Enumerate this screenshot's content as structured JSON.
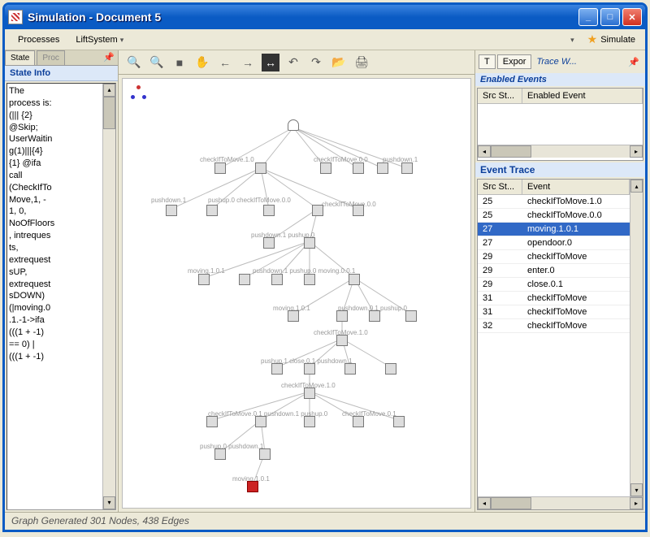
{
  "window": {
    "title": "Simulation - Document 5"
  },
  "menu": {
    "processes": "Processes",
    "liftsystem": "LiftSystem",
    "simulate": "Simulate"
  },
  "left": {
    "tabs": {
      "state": "State",
      "proc": "Proc",
      "pin": "📌"
    },
    "title": "State Info",
    "text": "The\nprocess is:\n(||| {2}\n@Skip;\nUserWaitin\ng(1)|||{4}\n{1} @ifa\ncall\n(CheckIfTo\nMove,1, -\n1, 0,\nNoOfFloors\n, intreques\nts,\nextrequest\nsUP,\nextrequest\nsDOWN)\n(|moving.0\n.1.-1->ifa\n(((1 + -1)\n== 0) |\n(((1 + -1)"
  },
  "toolbar": {
    "zoomin": "🔍",
    "zoomout": "🔍",
    "stop": "■",
    "hand": "✋",
    "back": "←",
    "fwd": "→",
    "fit": "↔",
    "undo": "↶",
    "redo": "↷",
    "open": "📂",
    "print": "🖨"
  },
  "graph": {
    "labels": {
      "l1": "checkIfToMove.1.0",
      "l2": "checkIfToMove.0.0",
      "l3": "pushdown.1",
      "l4": "pushdown.1",
      "l5": "pushup.0 checkIfToMove.0.0",
      "l6": "checkIfToMove.0.0",
      "l7": "pushdown.1  pushup.0",
      "l8": "moving.1.0.1",
      "l9": "pushdown.1  pushup.0  moving.0.0.1",
      "l10": "moving.1.0.1",
      "l11": "pushdown.0.1  pushup.0",
      "l12": "checkIfToMove.1.0",
      "l13": "pushup.1  close.0.1  pushdown.1",
      "l14": "checkIfToMove.1.0",
      "l15": "checkIfToMove.0.1  pushdown.1  pushup.0",
      "l16": "checkIfToMove.0.1",
      "l17": "pushup.0  pushdown.1",
      "l18": "moving.1.0.1"
    }
  },
  "right": {
    "t_btn": "T",
    "export_btn": "Expor",
    "tracehdr": "Trace W...",
    "enabled_title": "Enabled Events",
    "enabled_cols": {
      "src": "Src St...",
      "evt": "Enabled Event"
    },
    "trace_title": "Event Trace",
    "trace_cols": {
      "src": "Src St...",
      "evt": "Event"
    },
    "trace_rows": [
      {
        "src": "25",
        "evt": "checkIfToMove.1.0"
      },
      {
        "src": "25",
        "evt": "checkIfToMove.0.0"
      },
      {
        "src": "27",
        "evt": "moving.1.0.1",
        "sel": true
      },
      {
        "src": "27",
        "evt": "opendoor.0"
      },
      {
        "src": "29",
        "evt": "checkIfToMove"
      },
      {
        "src": "29",
        "evt": "enter.0"
      },
      {
        "src": "29",
        "evt": "close.0.1"
      },
      {
        "src": "31",
        "evt": "checkIfToMove"
      },
      {
        "src": "31",
        "evt": "checkIfToMove"
      },
      {
        "src": "32",
        "evt": "checkIfToMove"
      }
    ]
  },
  "status": "Graph Generated 301 Nodes, 438 Edges"
}
